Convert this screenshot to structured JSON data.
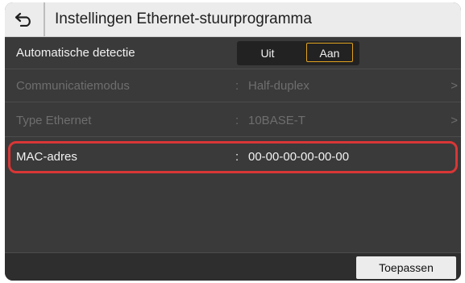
{
  "header": {
    "back_icon": "back-arrow-icon",
    "title": "Instellingen Ethernet-stuurprogramma"
  },
  "rows": [
    {
      "label": "Automatische detectie",
      "type": "toggle",
      "options": [
        "Uit",
        "Aan"
      ],
      "selected": "Aan"
    },
    {
      "label": "Communicatiemodus",
      "colon": ":",
      "value": "Half-duplex",
      "disabled": true,
      "chevron": ">"
    },
    {
      "label": "Type Ethernet",
      "colon": ":",
      "value": "10BASE-T",
      "disabled": true,
      "chevron": ">"
    },
    {
      "label": "MAC-adres",
      "colon": ":",
      "value": "00-00-00-00-00-00",
      "highlighted": true
    }
  ],
  "footer": {
    "apply_label": "Toepassen"
  },
  "colors": {
    "accent_selected": "#e0a21e",
    "highlight_ring": "#d93636"
  }
}
